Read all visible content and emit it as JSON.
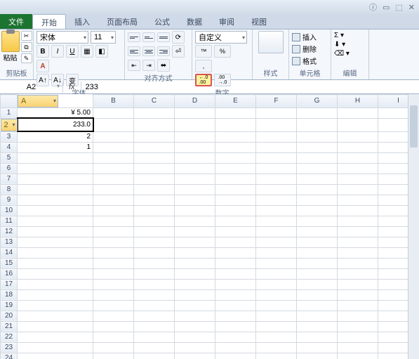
{
  "tabs": {
    "file": "文件",
    "items": [
      "开始",
      "插入",
      "页面布局",
      "公式",
      "数据",
      "审阅",
      "视图"
    ]
  },
  "ribbon": {
    "clipboard": {
      "title": "剪贴板",
      "paste": "粘贴"
    },
    "font": {
      "title": "字体",
      "name": "宋体",
      "size": "11",
      "b": "B",
      "i": "I",
      "u": "U",
      "a": "A"
    },
    "align": {
      "title": "对齐方式"
    },
    "number": {
      "title": "数字",
      "format": "自定义",
      "inc": "←.0\n.00",
      "dec": ".00\n→.0"
    },
    "styles": {
      "title": "样式"
    },
    "cells": {
      "title": "单元格",
      "insert": "插入",
      "delete": "删除",
      "format": "格式"
    },
    "edit": {
      "title": "编辑"
    }
  },
  "formula": {
    "cell": "A2",
    "fx": "fx",
    "value": "233"
  },
  "cols": [
    "A",
    "B",
    "C",
    "D",
    "E",
    "F",
    "G",
    "H",
    "I"
  ],
  "rows": 24,
  "cells": {
    "A1": "¥ 5.00",
    "A2": "233.0",
    "A3": "2",
    "A4": "1"
  },
  "active": "A2",
  "chart_data": {
    "type": "table",
    "title": "",
    "columns": [
      "A",
      "B",
      "C",
      "D",
      "E",
      "F",
      "G",
      "H",
      "I"
    ],
    "data": [
      {
        "row": 1,
        "A": "¥ 5.00"
      },
      {
        "row": 2,
        "A": "233.0"
      },
      {
        "row": 3,
        "A": 2
      },
      {
        "row": 4,
        "A": 1
      }
    ]
  }
}
